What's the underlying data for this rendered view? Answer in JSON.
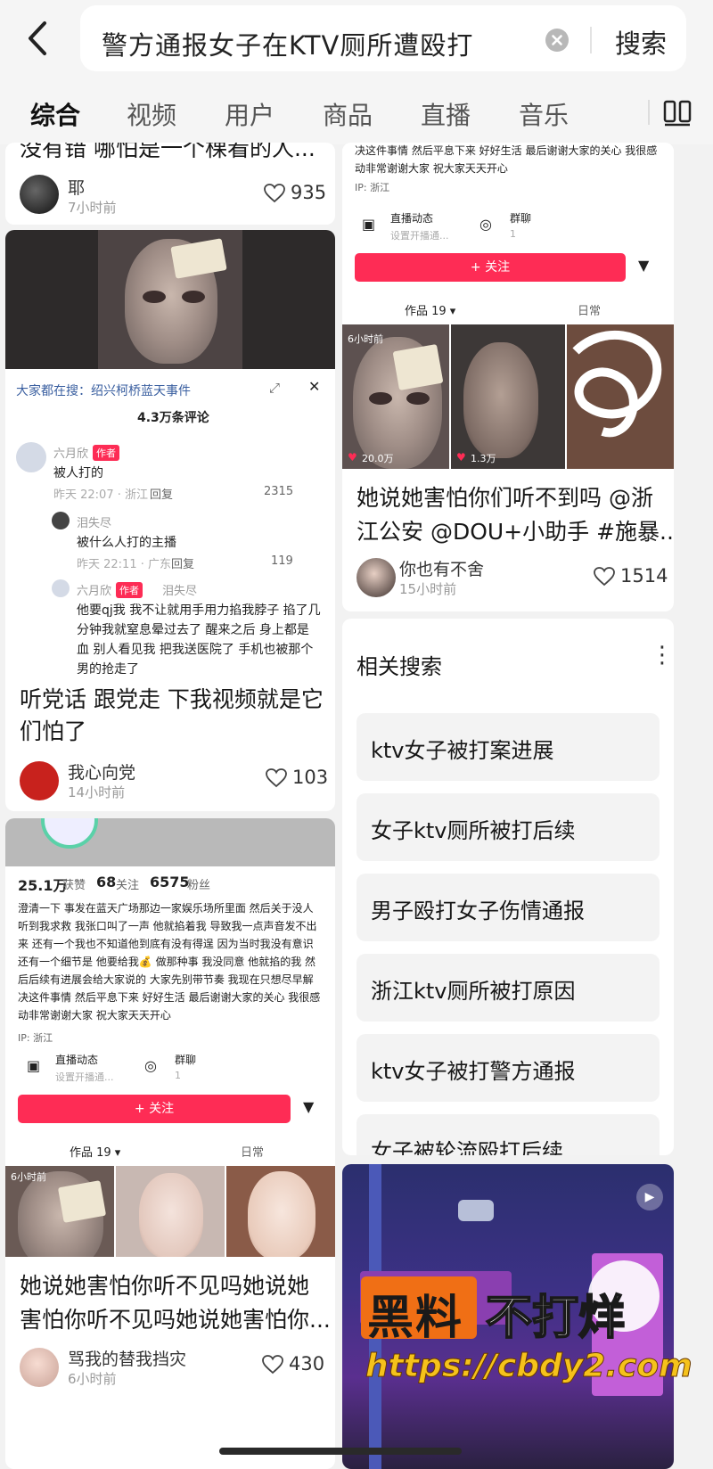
{
  "header": {
    "search_query": "警方通报女子在KTV厕所遭殴打",
    "search_button": "搜索"
  },
  "tabs": [
    "综合",
    "视频",
    "用户",
    "商品",
    "直播",
    "音乐"
  ],
  "left": {
    "card1": {
      "title_fragment": "没有错 哪怕是一个棵看的人...",
      "author": "耶",
      "time": "7小时前",
      "likes": "935"
    },
    "card2": {
      "shot": {
        "search_hint": "大家都在搜：绍兴柯桥蓝天事件",
        "comment_count": "4.3万条评论",
        "c1_user": "六月欣",
        "c1_tag": "作者",
        "c1_text": "被人打的",
        "c1_meta": "昨天 22:07 · 浙江",
        "c1_reply": "回复",
        "c1_likes": "2315",
        "c2_user": "泪失尽",
        "c2_text": "被什么人打的主播",
        "c2_meta": "昨天 22:11 · 广东",
        "c2_reply": "回复",
        "c2_likes": "119",
        "c3_user": "六月欣",
        "c3_tag": "作者",
        "c3_to": "泪失尽",
        "c3_text1": "他要qj我 我不让就用手用力掐我脖子 掐了几",
        "c3_text2": "分钟我就窒息晕过去了 醒来之后 身上都是",
        "c3_text3": "血 别人看见我 把我送医院了 手机也被那个",
        "c3_text4": "男的抢走了"
      },
      "title1": "听党话 跟党走 下我视频就是它",
      "title2": "们怕了",
      "author": "我心向党",
      "time": "14小时前",
      "likes": "103"
    },
    "card3": {
      "stats": {
        "likes_num": "25.1万",
        "likes_label": "获赞",
        "following_num": "68",
        "following_label": "关注",
        "fans_num": "6575",
        "fans_label": "粉丝"
      },
      "bio": [
        "澄清一下 事发在蓝天广场那边一家娱乐场所里面 然后关于没人",
        "听到我求救 我张口叫了一声 他就掐着我 导致我一点声音发不出",
        "来 还有一个我也不知道他到底有没有得逞 因为当时我没有意识",
        "还有一个细节是 他要给我💰 做那种事 我没同意 他就掐的我 然",
        "后后续有进展会给大家说的 大家先别带节奏 我现在只想尽早解",
        "决这件事情 然后平息下来 好好生活 最后谢谢大家的关心 我很感",
        "动非常谢谢大家 祝大家天天开心"
      ],
      "ip": "IP: 浙江",
      "live_label": "直播动态",
      "live_sub": "设置开播通...",
      "group_label": "群聊",
      "group_sub": "1",
      "follow": "+ 关注",
      "works_tab": "作品 19 ▾",
      "daily_tab": "日常",
      "thumb_time": "6小时前",
      "title1": "她说她害怕你听不见吗她说她",
      "title2": "害怕你听不见吗她说她害怕你...",
      "author": "骂我的替我挡灾",
      "time": "6小时前",
      "likes": "430"
    }
  },
  "right": {
    "card1": {
      "bio": [
        "决这件事情 然后平息下来 好好生活 最后谢谢大家的关心 我很感",
        "动非常谢谢大家 祝大家天天开心"
      ],
      "ip": "IP: 浙江",
      "live_label": "直播动态",
      "live_sub": "设置开播通...",
      "group_label": "群聊",
      "group_sub": "1",
      "follow": "+ 关注",
      "works_tab": "作品 19 ▾",
      "daily_tab": "日常",
      "thumb_time": "6小时前",
      "thumb_likes1": "20.0万",
      "thumb_likes2": "1.3万",
      "title1": "她说她害怕你们听不到吗 @浙",
      "title2": "江公安 @DOU+小助手 #施暴...",
      "author": "你也有不舍",
      "time": "15小时前",
      "likes": "1514"
    },
    "related": {
      "title": "相关搜索",
      "items": [
        "ktv女子被打案进展",
        "女子ktv厕所被打后续",
        "男子殴打女子伤情通报",
        "浙江ktv厕所被打原因",
        "ktv女子被打警方通报",
        "女子被轮流殴打后续"
      ]
    }
  },
  "watermark": {
    "part1": "黑料",
    "part2": "不打烊",
    "url": "https://cbdy2.com"
  }
}
